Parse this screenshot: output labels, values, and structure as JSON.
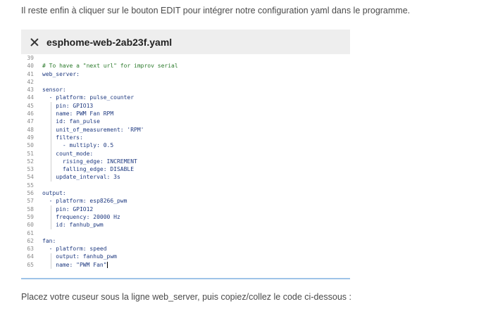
{
  "intro_text": "Il reste enfin à cliquer sur le bouton EDIT pour intégrer notre configuration yaml dans le programme.",
  "outro_text": "Placez votre cuseur sous la ligne web_server, puis copiez/collez le code ci-dessous :",
  "editor": {
    "filename": "esphome-web-2ab23f.yaml",
    "close_icon": "close-icon",
    "lines": [
      {
        "n": "39",
        "t": ""
      },
      {
        "n": "40",
        "t": "# To have a \"next url\" for improv serial",
        "k": "cmt"
      },
      {
        "n": "41",
        "t": "web_server:"
      },
      {
        "n": "42",
        "t": ""
      },
      {
        "n": "43",
        "t": "sensor:"
      },
      {
        "n": "44",
        "t": "  - platform: pulse_counter"
      },
      {
        "n": "45",
        "t": "    pin: GPIO13"
      },
      {
        "n": "46",
        "t": "    name: PWM Fan RPM"
      },
      {
        "n": "47",
        "t": "    id: fan_pulse"
      },
      {
        "n": "48",
        "t": "    unit_of_measurement: 'RPM'"
      },
      {
        "n": "49",
        "t": "    filters:"
      },
      {
        "n": "50",
        "t": "      - multiply: 0.5"
      },
      {
        "n": "51",
        "t": "    count_mode:"
      },
      {
        "n": "52",
        "t": "      rising_edge: INCREMENT"
      },
      {
        "n": "53",
        "t": "      falling_edge: DISABLE"
      },
      {
        "n": "54",
        "t": "    update_interval: 3s"
      },
      {
        "n": "55",
        "t": ""
      },
      {
        "n": "56",
        "t": "output:"
      },
      {
        "n": "57",
        "t": "  - platform: esp8266_pwm"
      },
      {
        "n": "58",
        "t": "    pin: GPIO12"
      },
      {
        "n": "59",
        "t": "    frequency: 20000 Hz"
      },
      {
        "n": "60",
        "t": "    id: fanhub_pwm"
      },
      {
        "n": "61",
        "t": ""
      },
      {
        "n": "62",
        "t": "fan:"
      },
      {
        "n": "63",
        "t": "  - platform: speed"
      },
      {
        "n": "64",
        "t": "    output: fanhub_pwm"
      },
      {
        "n": "65",
        "t": "    name: \"PWM Fan\""
      }
    ]
  }
}
